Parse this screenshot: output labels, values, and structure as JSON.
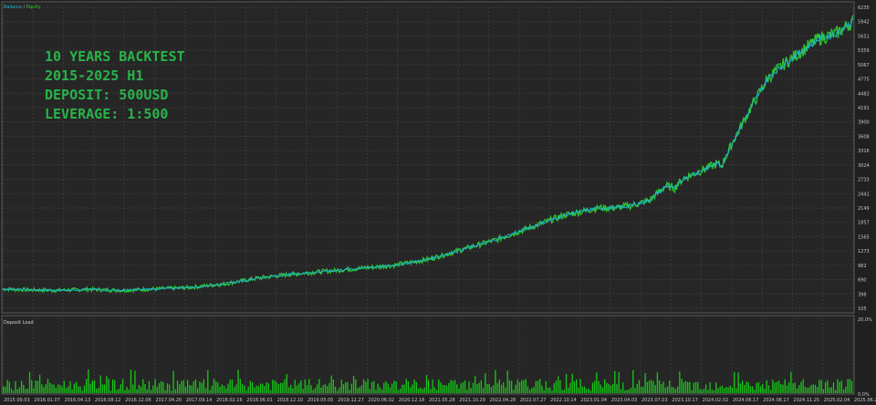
{
  "chart_data": [
    {
      "type": "line",
      "legend": [
        "Balance",
        "Equity"
      ],
      "legend_position": "top-left",
      "annotation_lines": [
        "10 YEARS BACKTEST",
        "2015-2025 H1",
        "DEPOSIT: 500USD",
        "LEVERAGE: 1:500"
      ],
      "grid": true,
      "ylim": [
        105,
        6235
      ],
      "y_ticks": [
        "6235",
        "5942",
        "5651",
        "5359",
        "5067",
        "4775",
        "4483",
        "4191",
        "3900",
        "3608",
        "3316",
        "3024",
        "2733",
        "2441",
        "2149",
        "1857",
        "1565",
        "1273",
        "982",
        "690",
        "398",
        "105"
      ],
      "x_ticks": [
        "2015.09.03",
        "2016.01.07",
        "2016.04.13",
        "2016.08.12",
        "2016.12.06",
        "2017.04.20",
        "2017.09.14",
        "2018.02.16",
        "2018.06.01",
        "2018.12.10",
        "2019.05.05",
        "2019.12.27",
        "2020.06.02",
        "2020.12.18",
        "2021.05.28",
        "2021.10.29",
        "2022.04.28",
        "2022.07.27",
        "2022.10.14",
        "2023.01.04",
        "2023.04.03",
        "2023.07.03",
        "2023.10.17",
        "2024.02.02",
        "2024.06.17",
        "2024.08.17",
        "2024.11.25",
        "2025.02.04",
        "2025.06.22"
      ],
      "series": [
        {
          "name": "Balance",
          "color": "#1fb6c8",
          "x": [
            0,
            0.03,
            0.06,
            0.1,
            0.14,
            0.18,
            0.22,
            0.26,
            0.3,
            0.34,
            0.38,
            0.42,
            0.46,
            0.5,
            0.54,
            0.58,
            0.62,
            0.66,
            0.7,
            0.72,
            0.74,
            0.76,
            0.78,
            0.79,
            0.8,
            0.82,
            0.84,
            0.845,
            0.86,
            0.88,
            0.9,
            0.92,
            0.94,
            0.96,
            0.98,
            1.0
          ],
          "values": [
            500,
            480,
            470,
            490,
            470,
            500,
            530,
            600,
            720,
            800,
            860,
            920,
            980,
            1100,
            1300,
            1500,
            1750,
            2000,
            2150,
            2150,
            2200,
            2300,
            2600,
            2550,
            2750,
            2900,
            3050,
            3000,
            3550,
            4200,
            4800,
            5100,
            5350,
            5600,
            5700,
            5950
          ]
        },
        {
          "name": "Equity",
          "color": "#2ec42e",
          "x": [
            0,
            0.03,
            0.06,
            0.1,
            0.14,
            0.18,
            0.22,
            0.26,
            0.3,
            0.34,
            0.38,
            0.42,
            0.46,
            0.5,
            0.54,
            0.58,
            0.62,
            0.66,
            0.7,
            0.72,
            0.74,
            0.76,
            0.78,
            0.79,
            0.8,
            0.82,
            0.84,
            0.845,
            0.86,
            0.88,
            0.9,
            0.92,
            0.94,
            0.96,
            0.98,
            1.0
          ],
          "values": [
            500,
            480,
            470,
            490,
            470,
            500,
            530,
            600,
            720,
            800,
            860,
            920,
            980,
            1100,
            1300,
            1500,
            1750,
            2000,
            2150,
            2150,
            2200,
            2300,
            2600,
            2550,
            2750,
            2900,
            3050,
            3000,
            3550,
            4200,
            4800,
            5100,
            5350,
            5600,
            5700,
            5950
          ]
        }
      ]
    },
    {
      "type": "bar",
      "title": "Deposit Load",
      "color": "#19c419",
      "ylim": [
        0,
        20.0
      ],
      "y_ticks": [
        "20.0%",
        "0.0%"
      ],
      "bar_count": 420,
      "typical_max": 6.5
    }
  ]
}
